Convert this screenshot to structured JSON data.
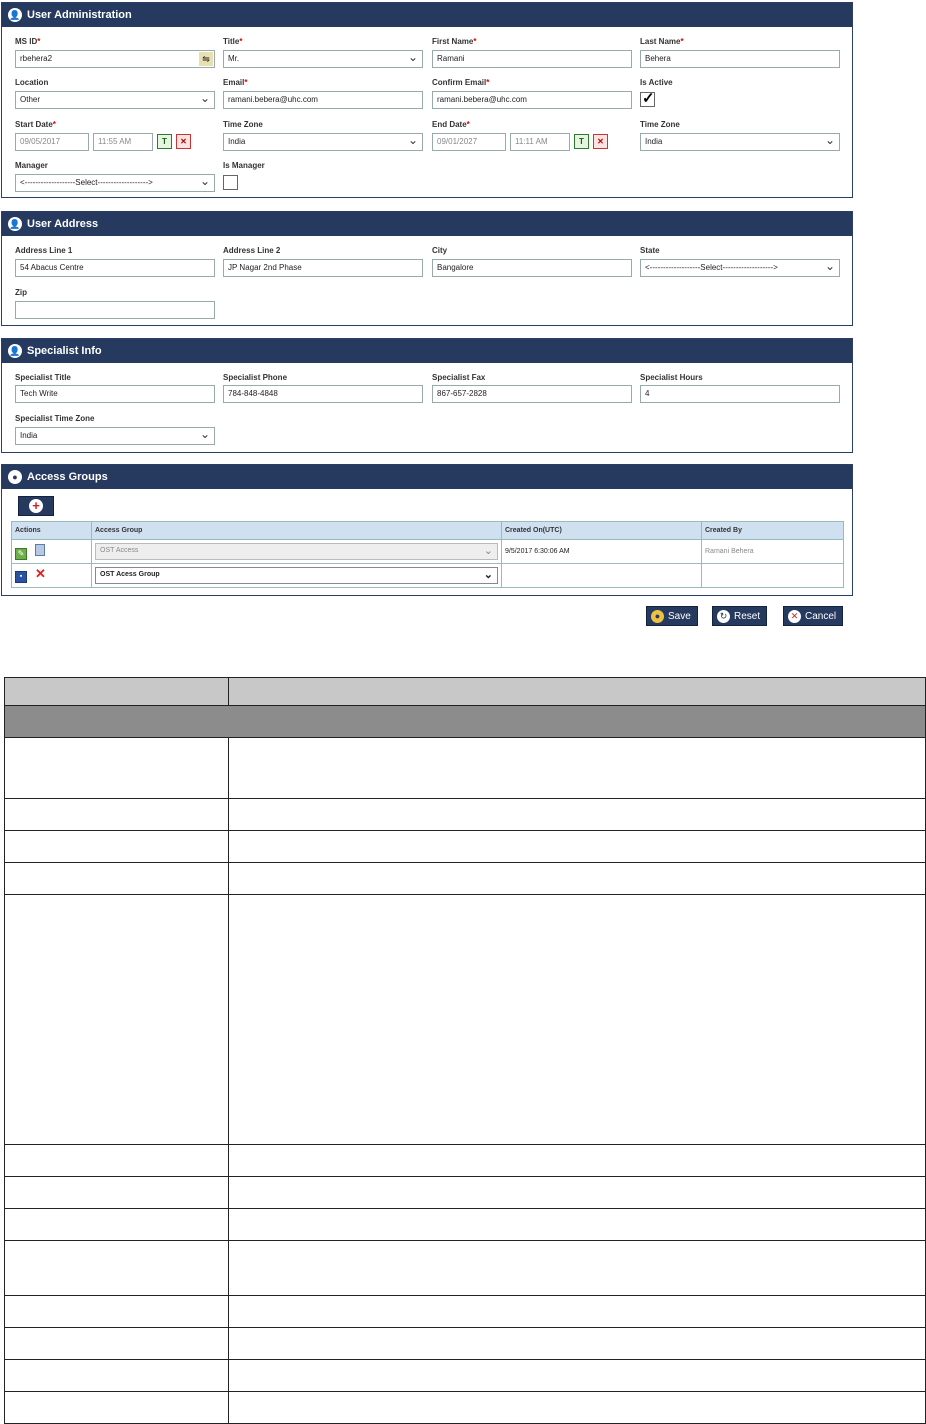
{
  "user_admin": {
    "title": "User Administration",
    "msid_label": "MS ID",
    "msid_value": "rbehera2",
    "title_label": "Title",
    "title_value": "Mr.",
    "first_name_label": "First Name",
    "first_name_value": "Ramani",
    "last_name_label": "Last Name",
    "last_name_value": "Behera",
    "location_label": "Location",
    "location_value": "Other",
    "email_label": "Email",
    "email_value": "ramani.bebera@uhc.com",
    "confirm_email_label": "Confirm Email",
    "confirm_email_value": "ramani.bebera@uhc.com",
    "is_active_label": "Is Active",
    "start_date_label": "Start Date",
    "start_date_value": "09/05/2017",
    "start_time_value": "11:55 AM",
    "time_zone_label": "Time Zone",
    "time_zone_value": "India",
    "end_date_label": "End Date",
    "end_date_value": "09/01/2027",
    "end_time_value": "11:11 AM",
    "time_zone2_label": "Time Zone",
    "time_zone2_value": "India",
    "manager_label": "Manager",
    "manager_value": "<-------------------Select------------------->",
    "is_manager_label": "Is Manager"
  },
  "user_address": {
    "title": "User Address",
    "addr1_label": "Address Line 1",
    "addr1_value": "54 Abacus Centre",
    "addr2_label": "Address Line 2",
    "addr2_value": "JP Nagar 2nd Phase",
    "city_label": "City",
    "city_value": "Bangalore",
    "state_label": "State",
    "state_value": "<-------------------Select------------------->",
    "zip_label": "Zip",
    "zip_value": ""
  },
  "specialist": {
    "title": "Specialist Info",
    "title_label": "Specialist Title",
    "title_value": "Tech Write",
    "phone_label": "Specialist Phone",
    "phone_value": "784-848-4848",
    "fax_label": "Specialist Fax",
    "fax_value": "867-657-2828",
    "hours_label": "Specialist Hours",
    "hours_value": "4",
    "tz_label": "Specialist Time Zone",
    "tz_value": "India"
  },
  "access_groups": {
    "title": "Access Groups",
    "columns": [
      "Actions",
      "Access Group",
      "Created On(UTC)",
      "Created By"
    ],
    "row1": {
      "group": "OST Access",
      "created_on": "9/5/2017 6:30:06 AM",
      "created_by": "Ramani Behera"
    },
    "row2": {
      "group": "OST Acess Group",
      "created_on": "",
      "created_by": ""
    }
  },
  "buttons": {
    "save": "Save",
    "reset": "Reset",
    "cancel": "Cancel"
  }
}
